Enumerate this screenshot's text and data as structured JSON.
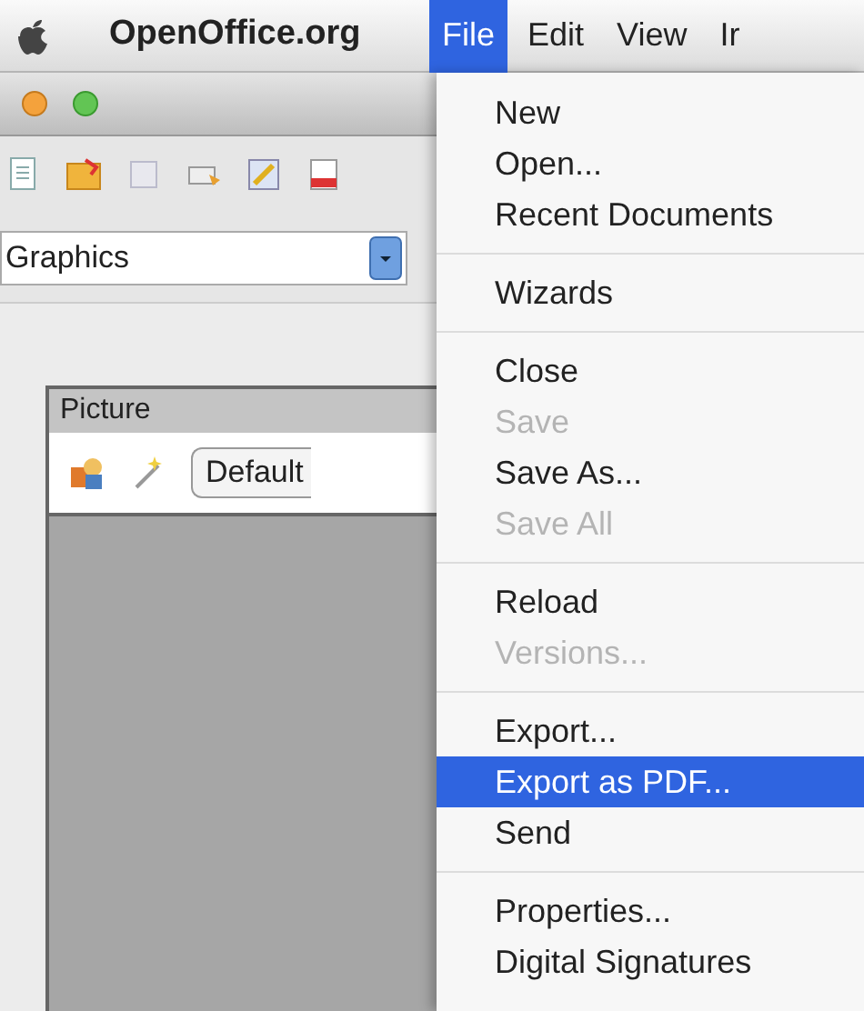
{
  "menubar": {
    "app_name": "OpenOffice.org",
    "menus": [
      {
        "label": "File",
        "selected": true
      },
      {
        "label": "Edit",
        "selected": false
      },
      {
        "label": "View",
        "selected": false
      },
      {
        "label": "Ir",
        "selected": false
      }
    ]
  },
  "window": {
    "style_field": {
      "value": "Graphics"
    },
    "picture_toolbar": {
      "title": "Picture",
      "mode_field": {
        "value": "Default"
      }
    }
  },
  "file_menu": {
    "groups": [
      [
        {
          "label": "New",
          "enabled": true,
          "selected": false
        },
        {
          "label": "Open...",
          "enabled": true,
          "selected": false
        },
        {
          "label": "Recent Documents",
          "enabled": true,
          "selected": false
        }
      ],
      [
        {
          "label": "Wizards",
          "enabled": true,
          "selected": false
        }
      ],
      [
        {
          "label": "Close",
          "enabled": true,
          "selected": false
        },
        {
          "label": "Save",
          "enabled": false,
          "selected": false
        },
        {
          "label": "Save As...",
          "enabled": true,
          "selected": false
        },
        {
          "label": "Save All",
          "enabled": false,
          "selected": false
        }
      ],
      [
        {
          "label": "Reload",
          "enabled": true,
          "selected": false
        },
        {
          "label": "Versions...",
          "enabled": false,
          "selected": false
        }
      ],
      [
        {
          "label": "Export...",
          "enabled": true,
          "selected": false
        },
        {
          "label": "Export as PDF...",
          "enabled": true,
          "selected": true
        },
        {
          "label": "Send",
          "enabled": true,
          "selected": false
        }
      ],
      [
        {
          "label": "Properties...",
          "enabled": true,
          "selected": false
        },
        {
          "label": "Digital Signatures",
          "enabled": true,
          "selected": false
        }
      ]
    ]
  }
}
